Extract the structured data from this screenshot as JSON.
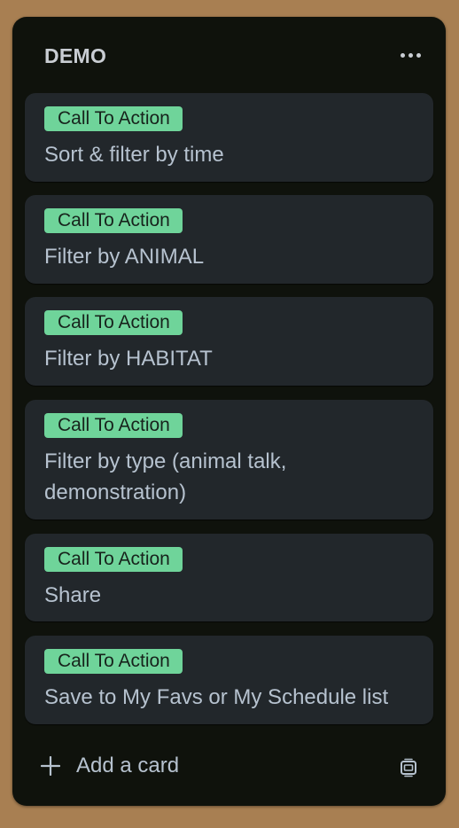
{
  "list": {
    "title": "DEMO",
    "menu_icon": "more-horizontal-icon",
    "cards": [
      {
        "label": "Call To Action",
        "title": "Sort & filter by time"
      },
      {
        "label": "Call To Action",
        "title": "Filter by ANIMAL"
      },
      {
        "label": "Call To Action",
        "title": "Filter by HABITAT"
      },
      {
        "label": "Call To Action",
        "title": "Filter by type (animal talk, demonstration)"
      },
      {
        "label": "Call To Action",
        "title": "Share"
      },
      {
        "label": "Call To Action",
        "title": "Save to My Favs or My Schedule list"
      }
    ],
    "add_card_label": "Add a card",
    "add_card_icon": "plus-icon",
    "template_icon": "card-template-icon"
  },
  "colors": {
    "board_background": "#a87f52",
    "list_background": "#0f120c",
    "card_background": "#22272b",
    "label_green": "#6fd49a",
    "text": "#b6c2cf"
  }
}
